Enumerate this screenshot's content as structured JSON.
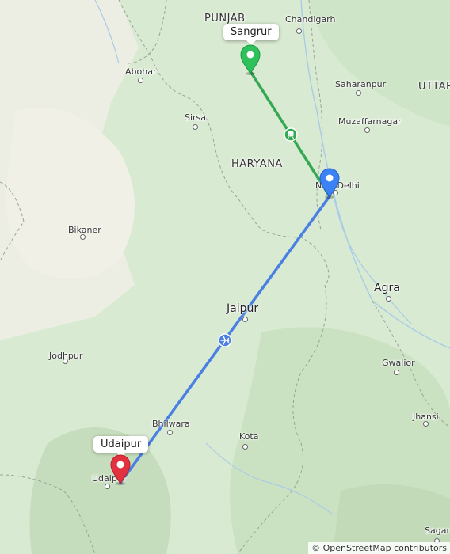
{
  "map": {
    "places": {
      "punjab": "PUNJAB",
      "chandigarh": "Chandigarh",
      "uttar": "UTTAR",
      "abohar": "Abohar",
      "saharanpur": "Saharanpur",
      "sirsa": "Sirsa",
      "muzaffarnagar": "Muzaffarnagar",
      "haryana": "HARYANA",
      "new_delhi": "New Delhi",
      "bikaner": "Bikaner",
      "agra": "Agra",
      "jaipur": "Jaipur",
      "jodhpur": "Jodhpur",
      "gwalior": "Gwalior",
      "bhilwara": "Bhilwara",
      "jhansi": "Jhansi",
      "kota": "Kota",
      "udaipur": "Udaipur",
      "sagar": "Sagar"
    },
    "markers": {
      "origin": "Sangrur",
      "destination": "Udaipur"
    },
    "route_colors": {
      "train_segment": "#34a853",
      "flight_segment": "#4a7fe3",
      "origin_pin": "#2ec05b",
      "stop_pin": "#3b82f6",
      "destination_pin": "#e2323f"
    },
    "segment_icons": [
      "train-icon",
      "airplane-icon"
    ],
    "attribution": "© OpenStreetMap contributors"
  }
}
